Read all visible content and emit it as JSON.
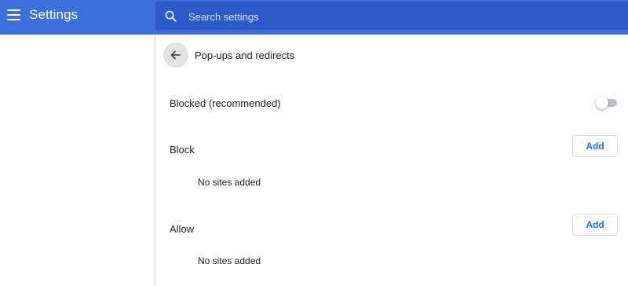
{
  "header": {
    "title": "Settings",
    "search": {
      "placeholder": "Search settings",
      "value": ""
    }
  },
  "page": {
    "title": "Pop-ups and redirects",
    "toggle": {
      "label": "Blocked (recommended)",
      "enabled": false
    },
    "block": {
      "label": "Block",
      "add_label": "Add",
      "empty_text": "No sites added"
    },
    "allow": {
      "label": "Allow",
      "add_label": "Add",
      "empty_text": "No sites added"
    }
  },
  "icons": {
    "menu": "hamburger-menu-icon",
    "search": "search-icon",
    "back": "arrow-back-icon"
  },
  "colors": {
    "header": "#3c6fd9",
    "search_bg": "#2c5ac9",
    "accent": "#1a73e8"
  }
}
